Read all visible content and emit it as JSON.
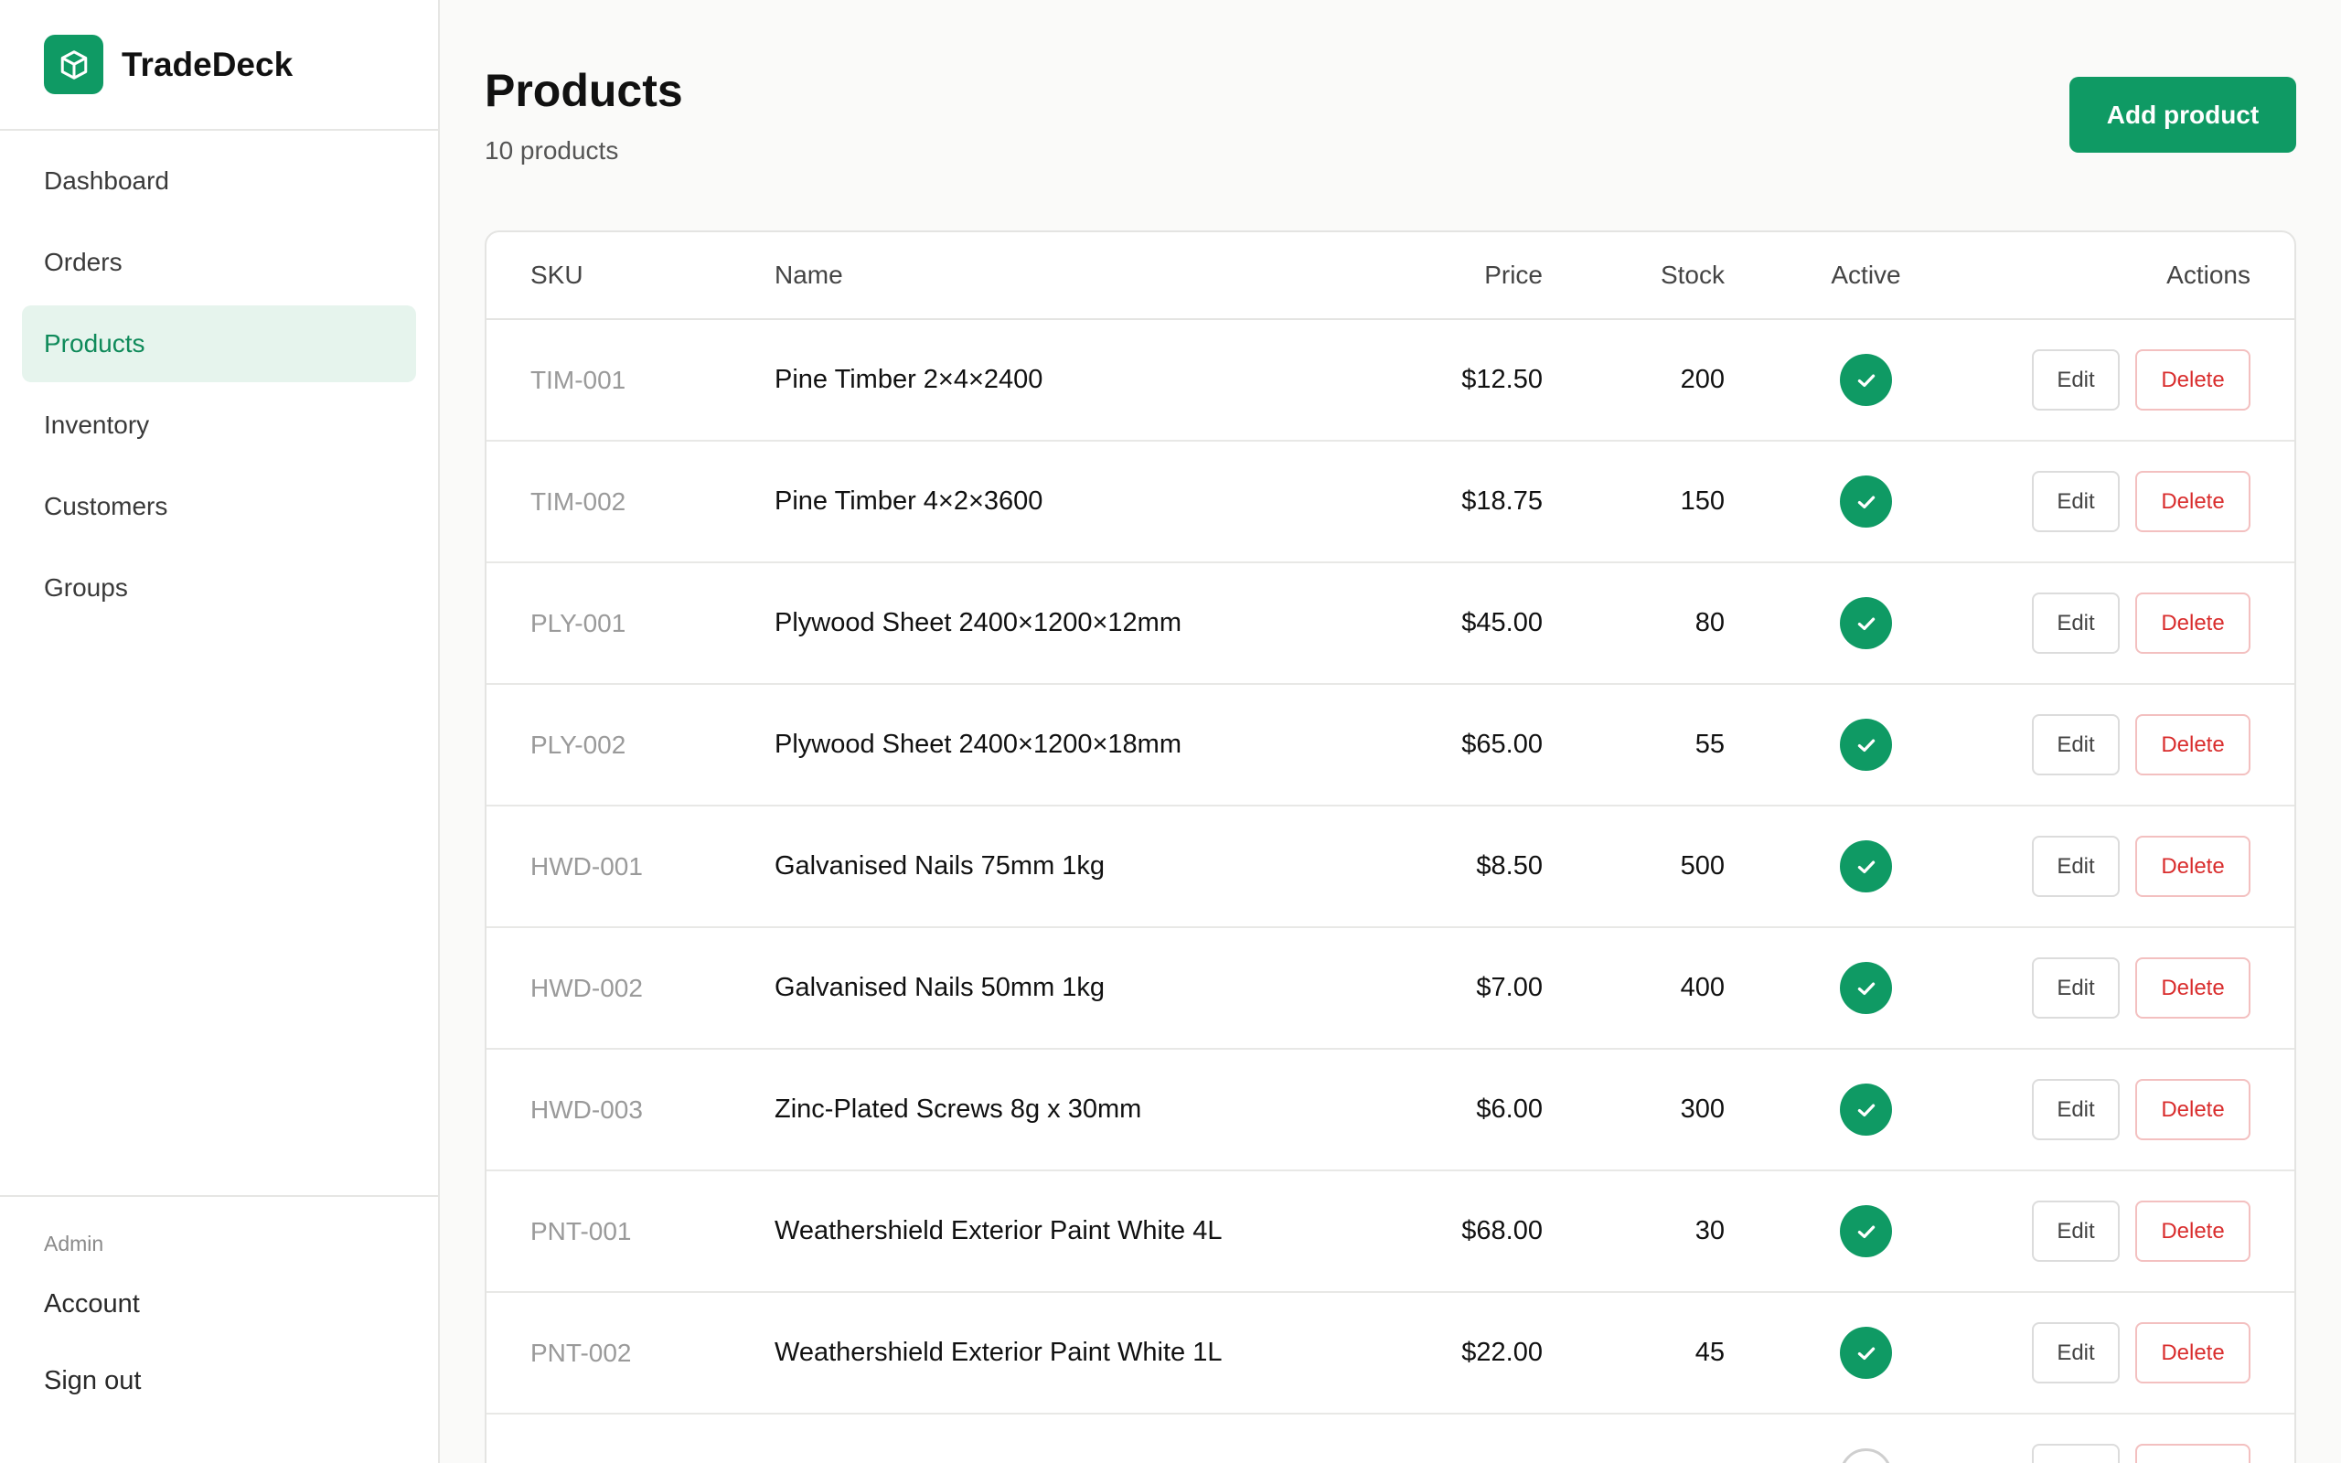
{
  "brand": {
    "name": "TradeDeck",
    "accent": "#0f9a64"
  },
  "nav": {
    "items": [
      {
        "label": "Dashboard",
        "active": false
      },
      {
        "label": "Orders",
        "active": false
      },
      {
        "label": "Products",
        "active": true
      },
      {
        "label": "Inventory",
        "active": false
      },
      {
        "label": "Customers",
        "active": false
      },
      {
        "label": "Groups",
        "active": false
      }
    ]
  },
  "sidebar_bottom": {
    "section_label": "Admin",
    "items": [
      {
        "label": "Account"
      },
      {
        "label": "Sign out"
      }
    ]
  },
  "header": {
    "title": "Products",
    "subtitle": "10 products",
    "add_label": "Add product"
  },
  "table": {
    "columns": {
      "sku": "SKU",
      "name": "Name",
      "price": "Price",
      "stock": "Stock",
      "active": "Active",
      "actions": "Actions"
    },
    "edit_label": "Edit",
    "delete_label": "Delete",
    "rows": [
      {
        "sku": "TIM-001",
        "name": "Pine Timber 2×4×2400",
        "price": "$12.50",
        "stock": "200",
        "active": true
      },
      {
        "sku": "TIM-002",
        "name": "Pine Timber 4×2×3600",
        "price": "$18.75",
        "stock": "150",
        "active": true
      },
      {
        "sku": "PLY-001",
        "name": "Plywood Sheet 2400×1200×12mm",
        "price": "$45.00",
        "stock": "80",
        "active": true
      },
      {
        "sku": "PLY-002",
        "name": "Plywood Sheet 2400×1200×18mm",
        "price": "$65.00",
        "stock": "55",
        "active": true
      },
      {
        "sku": "HWD-001",
        "name": "Galvanised Nails 75mm 1kg",
        "price": "$8.50",
        "stock": "500",
        "active": true
      },
      {
        "sku": "HWD-002",
        "name": "Galvanised Nails 50mm 1kg",
        "price": "$7.00",
        "stock": "400",
        "active": true
      },
      {
        "sku": "HWD-003",
        "name": "Zinc-Plated Screws 8g x 30mm",
        "price": "$6.00",
        "stock": "300",
        "active": true
      },
      {
        "sku": "PNT-001",
        "name": "Weathershield Exterior Paint White 4L",
        "price": "$68.00",
        "stock": "30",
        "active": true
      },
      {
        "sku": "PNT-002",
        "name": "Weathershield Exterior Paint White 1L",
        "price": "$22.00",
        "stock": "45",
        "active": true
      },
      {
        "sku": "",
        "name": "",
        "price": "",
        "stock": "",
        "active": false
      }
    ]
  }
}
